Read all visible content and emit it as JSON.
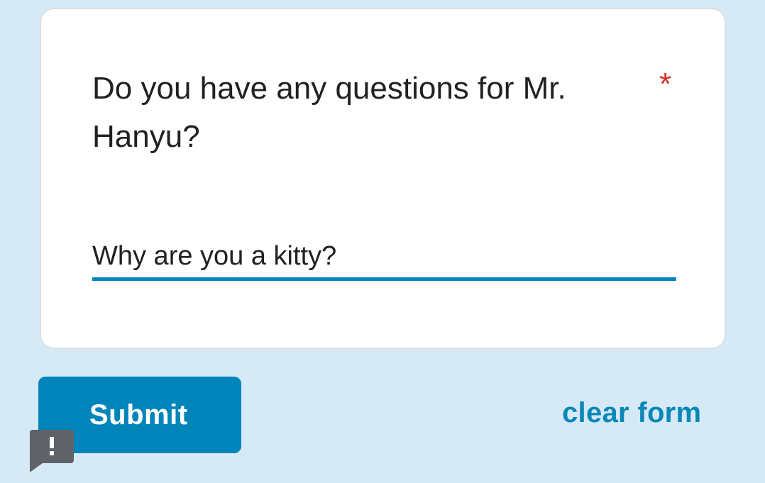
{
  "question": {
    "title": "Do you have any questions for Mr. Hanyu?",
    "required_marker": "*",
    "answer_value": "Why are you a kitty?"
  },
  "actions": {
    "submit_label": "Submit",
    "clear_label": "clear form"
  },
  "icons": {
    "feedback": "report-feedback-icon"
  },
  "colors": {
    "page_background": "#d5e9f7",
    "accent": "#0085ba",
    "required": "#d93025",
    "text": "#202124"
  }
}
